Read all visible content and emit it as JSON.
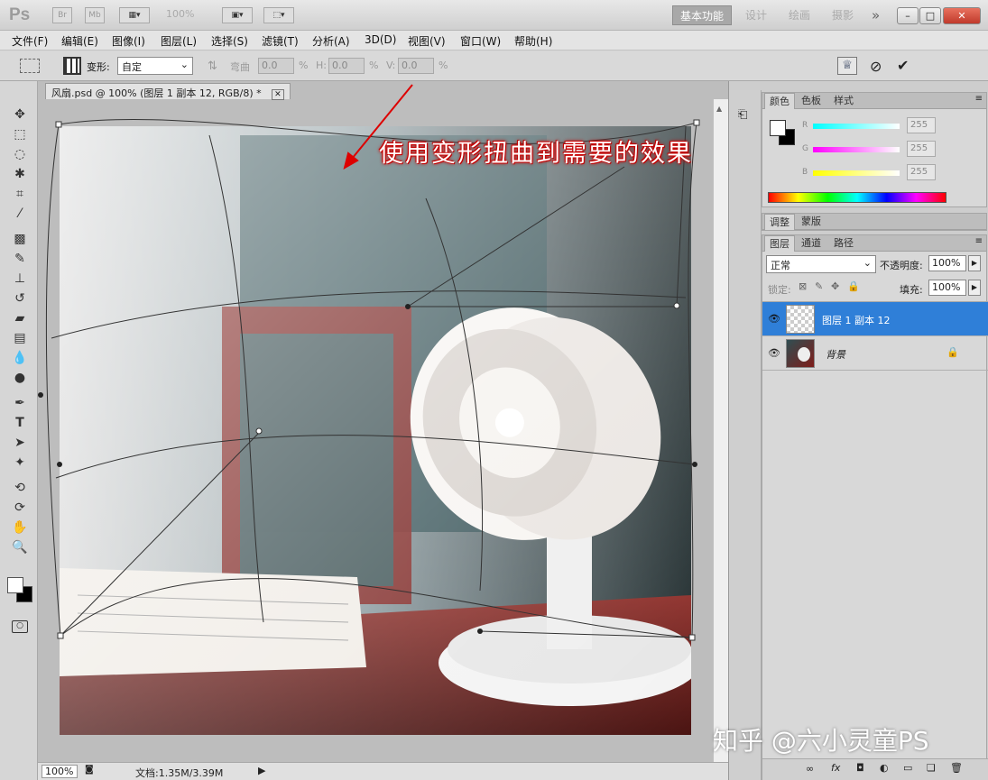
{
  "app": {
    "logo": "Ps",
    "titlebar": {
      "br": "Br",
      "mb": "Mb",
      "zoom": "100%"
    },
    "workspaces": [
      "基本功能",
      "设计",
      "绘画",
      "摄影"
    ],
    "more": "»",
    "window_controls": [
      "–",
      "□",
      "✕"
    ]
  },
  "menu": [
    "文件(F)",
    "编辑(E)",
    "图像(I)",
    "图层(L)",
    "选择(S)",
    "滤镜(T)",
    "分析(A)",
    "3D(D)",
    "视图(V)",
    "窗口(W)",
    "帮助(H)"
  ],
  "options": {
    "transform_label": "变形:",
    "transform_value": "自定",
    "bend_label": "弯曲",
    "bend_value": "0.0",
    "h_label": "H:",
    "h_value": "0.0",
    "v_label": "V:",
    "v_value": "0.0",
    "percent": "%"
  },
  "document": {
    "tab_title": "风扇.psd @ 100% (图层 1 副本 12, RGB/8) *",
    "annotation": "使用变形扭曲到需要的效果",
    "watermark": "知乎 @六小灵童PS"
  },
  "status": {
    "zoom": "100%",
    "doc_info": "文档:1.35M/3.39M"
  },
  "color_panel": {
    "tabs": [
      "颜色",
      "色板",
      "样式"
    ],
    "r_label": "R",
    "g_label": "G",
    "b_label": "B",
    "r_value": "255",
    "g_value": "255",
    "b_value": "255"
  },
  "adjust_panel": {
    "tabs": [
      "调整",
      "蒙版"
    ]
  },
  "layers_panel": {
    "tabs": [
      "图层",
      "通道",
      "路径"
    ],
    "blend_mode": "正常",
    "opacity_label": "不透明度:",
    "opacity_value": "100%",
    "lock_label": "锁定:",
    "fill_label": "填充:",
    "fill_value": "100%",
    "layers": [
      {
        "name": "图层 1 副本 12",
        "selected": true
      },
      {
        "name": "背景",
        "selected": false
      }
    ],
    "footer_icons": [
      "link-icon",
      "fx-icon",
      "mask-icon",
      "adjustment-icon",
      "folder-icon",
      "new-layer-icon",
      "trash-icon"
    ]
  },
  "colors": {
    "accent": "#2f7fd8",
    "annotation_red": "#cc0000"
  }
}
